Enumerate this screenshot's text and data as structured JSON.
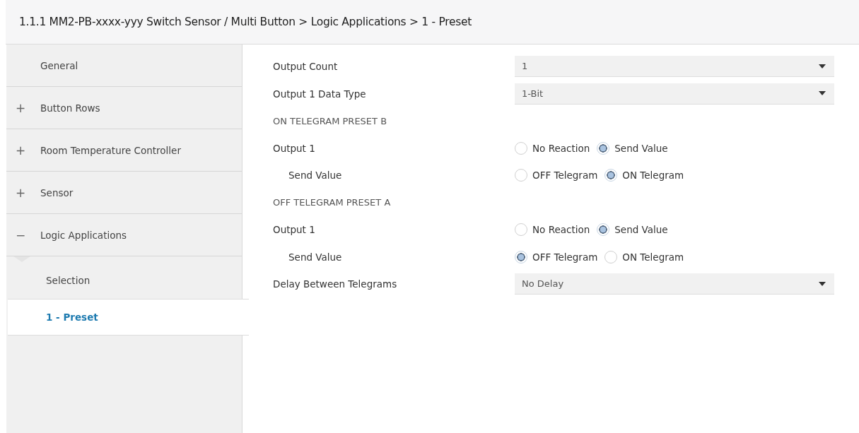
{
  "header": {
    "title": "1.1.1 MM2-PB-xxxx-yyy Switch Sensor / Multi Button > Logic Applications > 1 - Preset"
  },
  "sidebar": {
    "items": [
      {
        "label": "General",
        "selected": false
      },
      {
        "sign": "+",
        "label": "Button Rows",
        "selected": false
      },
      {
        "sign": "+",
        "label": "Room Temperature Controller",
        "selected": false
      },
      {
        "sign": "+",
        "label": "Sensor",
        "selected": false
      },
      {
        "sign": "−",
        "label": "Logic Applications",
        "selected": false,
        "expanded": true,
        "children": [
          {
            "label": "Selection",
            "selected": false
          },
          {
            "label": "1 - Preset",
            "selected": true
          }
        ]
      }
    ]
  },
  "parameters": [
    {
      "kind": "dropdown",
      "label": "Output Count",
      "value": "1"
    },
    {
      "kind": "dropdown",
      "label": "Output 1 Data Type",
      "value": "1-Bit"
    },
    {
      "kind": "heading",
      "label": "ON TELEGRAM PRESET B"
    },
    {
      "kind": "radio",
      "label": "Output 1",
      "options": [
        {
          "label": "No Reaction",
          "selected": false
        },
        {
          "label": "Send Value",
          "selected": true
        }
      ],
      "children": [
        {
          "kind": "radio",
          "label": "Send Value",
          "options": [
            {
              "label": "OFF Telegram",
              "selected": false
            },
            {
              "label": "ON Telegram",
              "selected": true
            }
          ]
        }
      ]
    },
    {
      "kind": "heading",
      "label": "OFF TELEGRAM PRESET A"
    },
    {
      "kind": "radio",
      "label": "Output 1",
      "options": [
        {
          "label": "No Reaction",
          "selected": false
        },
        {
          "label": "Send Value",
          "selected": true
        }
      ],
      "children": [
        {
          "kind": "radio",
          "label": "Send Value",
          "options": [
            {
              "label": "OFF Telegram",
              "selected": true
            },
            {
              "label": "ON Telegram",
              "selected": false
            }
          ]
        }
      ]
    },
    {
      "kind": "dropdown",
      "label": "Delay Between Telegrams",
      "value": "No Delay"
    }
  ]
}
